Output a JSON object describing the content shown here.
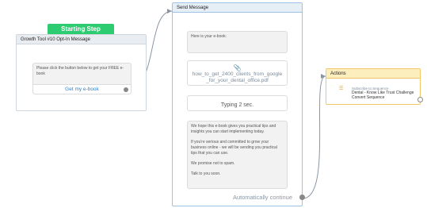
{
  "start_badge": "Starting Step",
  "optin_node": {
    "title": "Growth Tool #10 Opt-In Message",
    "message": "Please click the button below to get your FREE e-book",
    "button_label": "Get my e-book"
  },
  "send_node": {
    "title": "Send Message",
    "messages": [
      "Here is your e-book:",
      "how_to_get_2400_clients_from_google_for_your_dental_office.pdf",
      "Typing 2 sec.",
      "We hope this e-book gives you practical tips and insights you can start implementing today.",
      "If you're serious and committed to grow your business online - we will be sending you practical tips that you can use.",
      "We promise not to spam.",
      "Talk to you soon."
    ],
    "auto_continue": "Automatically continue"
  },
  "actions_node": {
    "title": "Actions",
    "action_type": "Subscribe to Sequence",
    "action_value": "Dental - Know Like Trust Challenge Convert Sequence"
  },
  "colors": {
    "start_badge": "#2ecc71",
    "link": "#2f80d1",
    "actions_accent": "#f0c86a"
  }
}
